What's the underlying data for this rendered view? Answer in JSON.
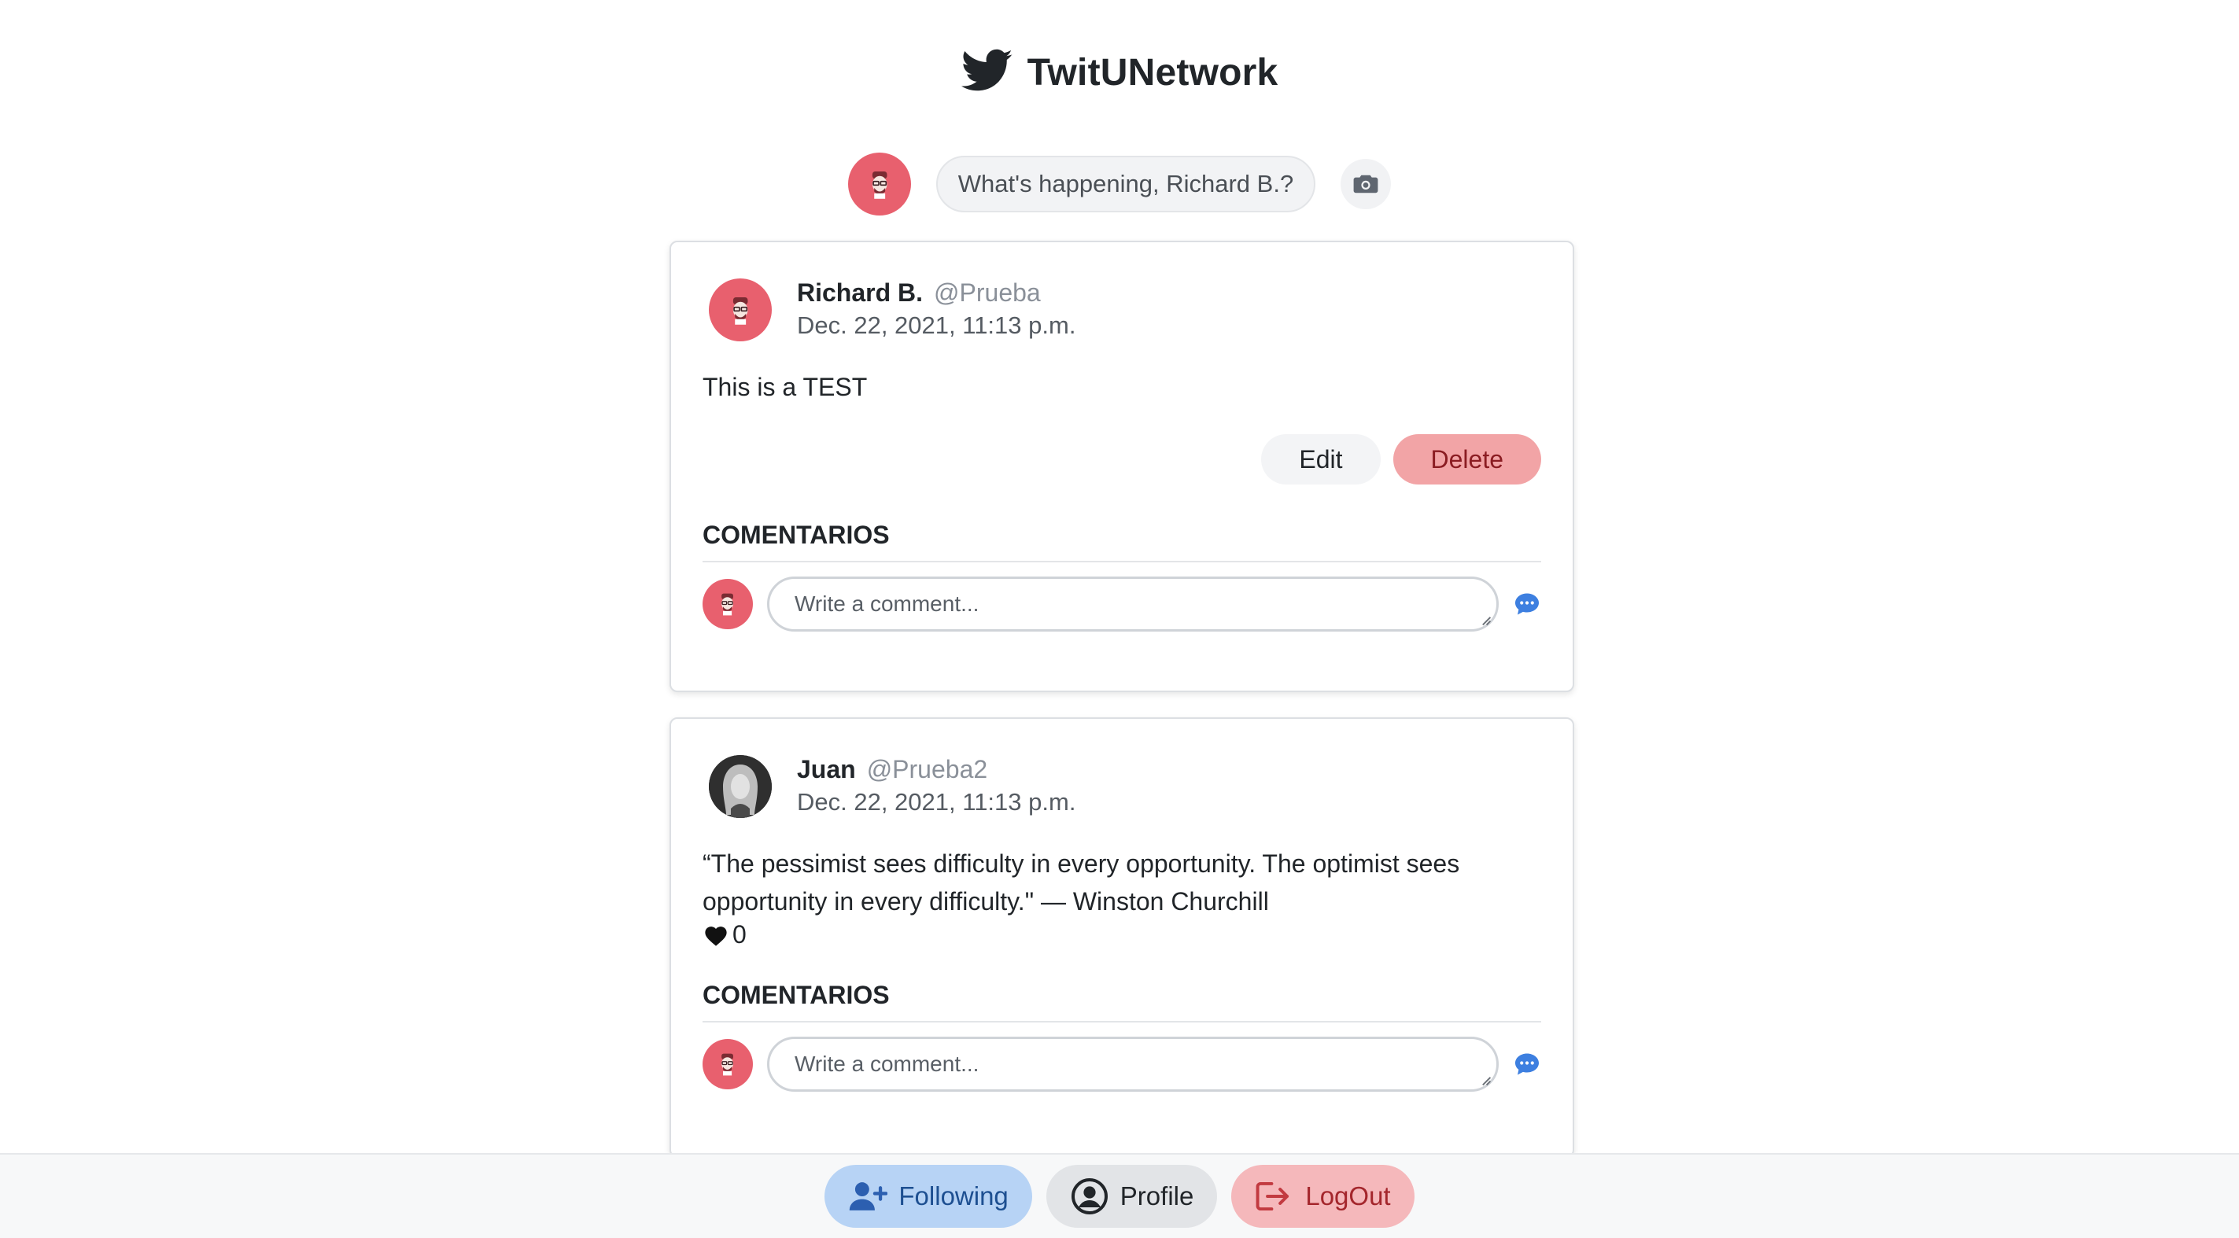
{
  "app": {
    "title": "TwitUNetwork",
    "brand_icon": "twitter-bird-icon",
    "accent_color": "#1d4f91"
  },
  "composer": {
    "placeholder": "What's happening, Richard B.?",
    "camera_icon": "camera-icon"
  },
  "posts": [
    {
      "author_name": "Richard B.",
      "author_handle": "@Prueba",
      "date": "Dec. 22, 2021, 11:13 p.m.",
      "text": "This is a TEST",
      "edit_label": "Edit",
      "delete_label": "Delete",
      "comments_title": "COMENTARIOS",
      "comment_placeholder": "Write a comment..."
    },
    {
      "author_name": "Juan",
      "author_handle": "@Prueba2",
      "date": "Dec. 22, 2021, 11:13 p.m.",
      "text": "“The pessimist sees difficulty in every opportunity. The optimist sees opportunity in every difficulty.\" — Winston Churchill",
      "likes": "0",
      "comments_title": "COMENTARIOS",
      "comment_placeholder": "Write a comment..."
    }
  ],
  "footer": {
    "following_label": "Following",
    "profile_label": "Profile",
    "logout_label": "LogOut"
  }
}
